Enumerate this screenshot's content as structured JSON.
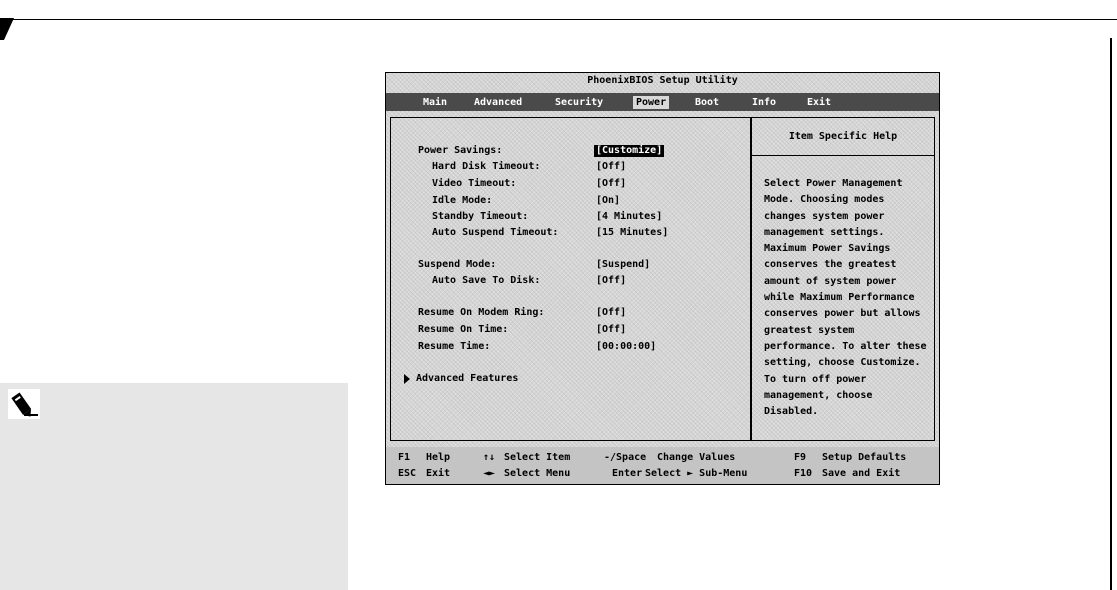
{
  "bios": {
    "title": "PhoenixBIOS Setup Utility",
    "menu": [
      {
        "label": "Main",
        "active": false
      },
      {
        "label": "Advanced",
        "active": false
      },
      {
        "label": "Security",
        "active": false
      },
      {
        "label": "Power",
        "active": true
      },
      {
        "label": "Boot",
        "active": false
      },
      {
        "label": "Info",
        "active": false
      },
      {
        "label": "Exit",
        "active": false
      }
    ],
    "settings": [
      {
        "label": "Power Savings:",
        "value": "[Customize]"
      },
      {
        "label": "Hard Disk Timeout:",
        "value": "[Off]"
      },
      {
        "label": "Video Timeout:",
        "value": "[Off]"
      },
      {
        "label": "Idle Mode:",
        "value": "[On]"
      },
      {
        "label": "Standby Timeout:",
        "value": "[4 Minutes]"
      },
      {
        "label": "Auto Suspend Timeout:",
        "value": "[15 Minutes]"
      },
      {
        "label": "Suspend Mode:",
        "value": "[Suspend]"
      },
      {
        "label": "Auto Save To Disk:",
        "value": "[Off]"
      },
      {
        "label": "Resume On Modem Ring:",
        "value": "[Off]"
      },
      {
        "label": "Resume On Time:",
        "value": "[Off]"
      },
      {
        "label": "Resume Time:",
        "value": "[00:00:00]"
      }
    ],
    "submenu": "Advanced Features",
    "help_title": "Item Specific Help",
    "help_text": "Select Power Management Mode. Choosing modes changes system power management settings. Maximum Power Savings conserves the greatest amount of system power while Maximum Performance conserves power but allows greatest system performance. To alter these setting, choose Customize. To turn off power management, choose Disabled.",
    "footer": {
      "f1_key": "F1",
      "f1_label": "Help",
      "up_down_key": "↑↓",
      "up_down_label": "Select Item",
      "minus_space_key": "-/Space",
      "minus_space_label": "Change Values",
      "f9_key": "F9",
      "f9_label": "Setup Defaults",
      "esc_key": "ESC",
      "esc_label": "Exit",
      "left_right_key": "◄►",
      "left_right_label": "Select Menu",
      "enter_key": "Enter",
      "enter_label": "Select ► Sub-Menu",
      "f10_key": "F10",
      "f10_label": "Save and Exit"
    }
  },
  "colors": {
    "menubar": "#4a4a4a",
    "screen": "#d6d6d6",
    "note_box": "#e6e6e6"
  },
  "icons": {
    "note": "pen-note-icon",
    "submenu": "triangle-right-icon"
  }
}
